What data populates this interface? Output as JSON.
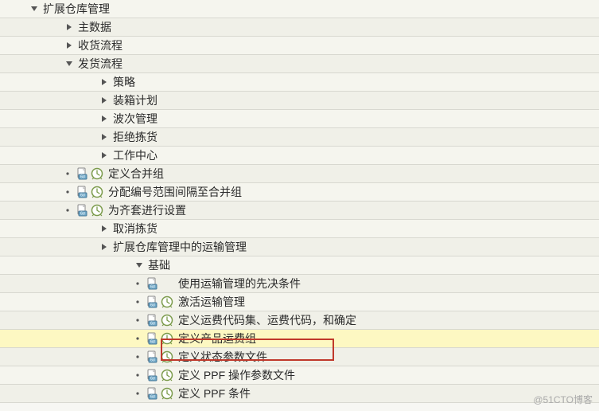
{
  "tree": {
    "n0": {
      "label": "扩展仓库管理",
      "indent": 36,
      "caret": "down",
      "icons": false,
      "alt": false,
      "hl": false
    },
    "n1": {
      "label": "主数据",
      "indent": 80,
      "caret": "right",
      "icons": false,
      "alt": true,
      "hl": false
    },
    "n2": {
      "label": "收货流程",
      "indent": 80,
      "caret": "right",
      "icons": false,
      "alt": false,
      "hl": false
    },
    "n3": {
      "label": "发货流程",
      "indent": 80,
      "caret": "down",
      "icons": false,
      "alt": true,
      "hl": false
    },
    "n4": {
      "label": "策略",
      "indent": 124,
      "caret": "right",
      "icons": false,
      "alt": false,
      "hl": false
    },
    "n5": {
      "label": "装箱计划",
      "indent": 124,
      "caret": "right",
      "icons": false,
      "alt": true,
      "hl": false
    },
    "n6": {
      "label": "波次管理",
      "indent": 124,
      "caret": "right",
      "icons": false,
      "alt": false,
      "hl": false
    },
    "n7": {
      "label": "拒绝拣货",
      "indent": 124,
      "caret": "right",
      "icons": false,
      "alt": true,
      "hl": false
    },
    "n8": {
      "label": "工作中心",
      "indent": 124,
      "caret": "right",
      "icons": false,
      "alt": false,
      "hl": false
    },
    "n9": {
      "label": "定义合并组",
      "indent": 78,
      "caret": "dot",
      "icons": true,
      "alt": true,
      "hl": false
    },
    "n10": {
      "label": "分配编号范围间隔至合并组",
      "indent": 78,
      "caret": "dot",
      "icons": true,
      "alt": false,
      "hl": false
    },
    "n11": {
      "label": "为齐套进行设置",
      "indent": 78,
      "caret": "dot",
      "icons": true,
      "alt": true,
      "hl": false
    },
    "n12": {
      "label": "取消拣货",
      "indent": 124,
      "caret": "right",
      "icons": false,
      "alt": false,
      "hl": false
    },
    "n13": {
      "label": "扩展仓库管理中的运输管理",
      "indent": 124,
      "caret": "right",
      "icons": false,
      "alt": true,
      "hl": false
    },
    "n14": {
      "label": "基础",
      "indent": 168,
      "caret": "down",
      "icons": false,
      "alt": false,
      "hl": false
    },
    "n15": {
      "label": "使用运输管理的先决条件",
      "indent": 166,
      "caret": "dot",
      "icons": "doc",
      "alt": true,
      "hl": false
    },
    "n16": {
      "label": "激活运输管理",
      "indent": 166,
      "caret": "dot",
      "icons": true,
      "alt": false,
      "hl": false
    },
    "n17": {
      "label": "定义运费代码集、运费代码，和确定",
      "indent": 166,
      "caret": "dot",
      "icons": true,
      "alt": true,
      "hl": false
    },
    "n18": {
      "label": "定义产品运费组",
      "indent": 166,
      "caret": "dot",
      "icons": true,
      "alt": false,
      "hl": true
    },
    "n19": {
      "label": "定义状态参数文件",
      "indent": 166,
      "caret": "dot",
      "icons": true,
      "alt": true,
      "hl": false
    },
    "n20": {
      "label": "定义 PPF 操作参数文件",
      "indent": 166,
      "caret": "dot",
      "icons": true,
      "alt": false,
      "hl": false
    },
    "n21": {
      "label": "定义 PPF 条件",
      "indent": 166,
      "caret": "dot",
      "icons": true,
      "alt": true,
      "hl": false
    }
  },
  "watermark": "@51CTO博客"
}
